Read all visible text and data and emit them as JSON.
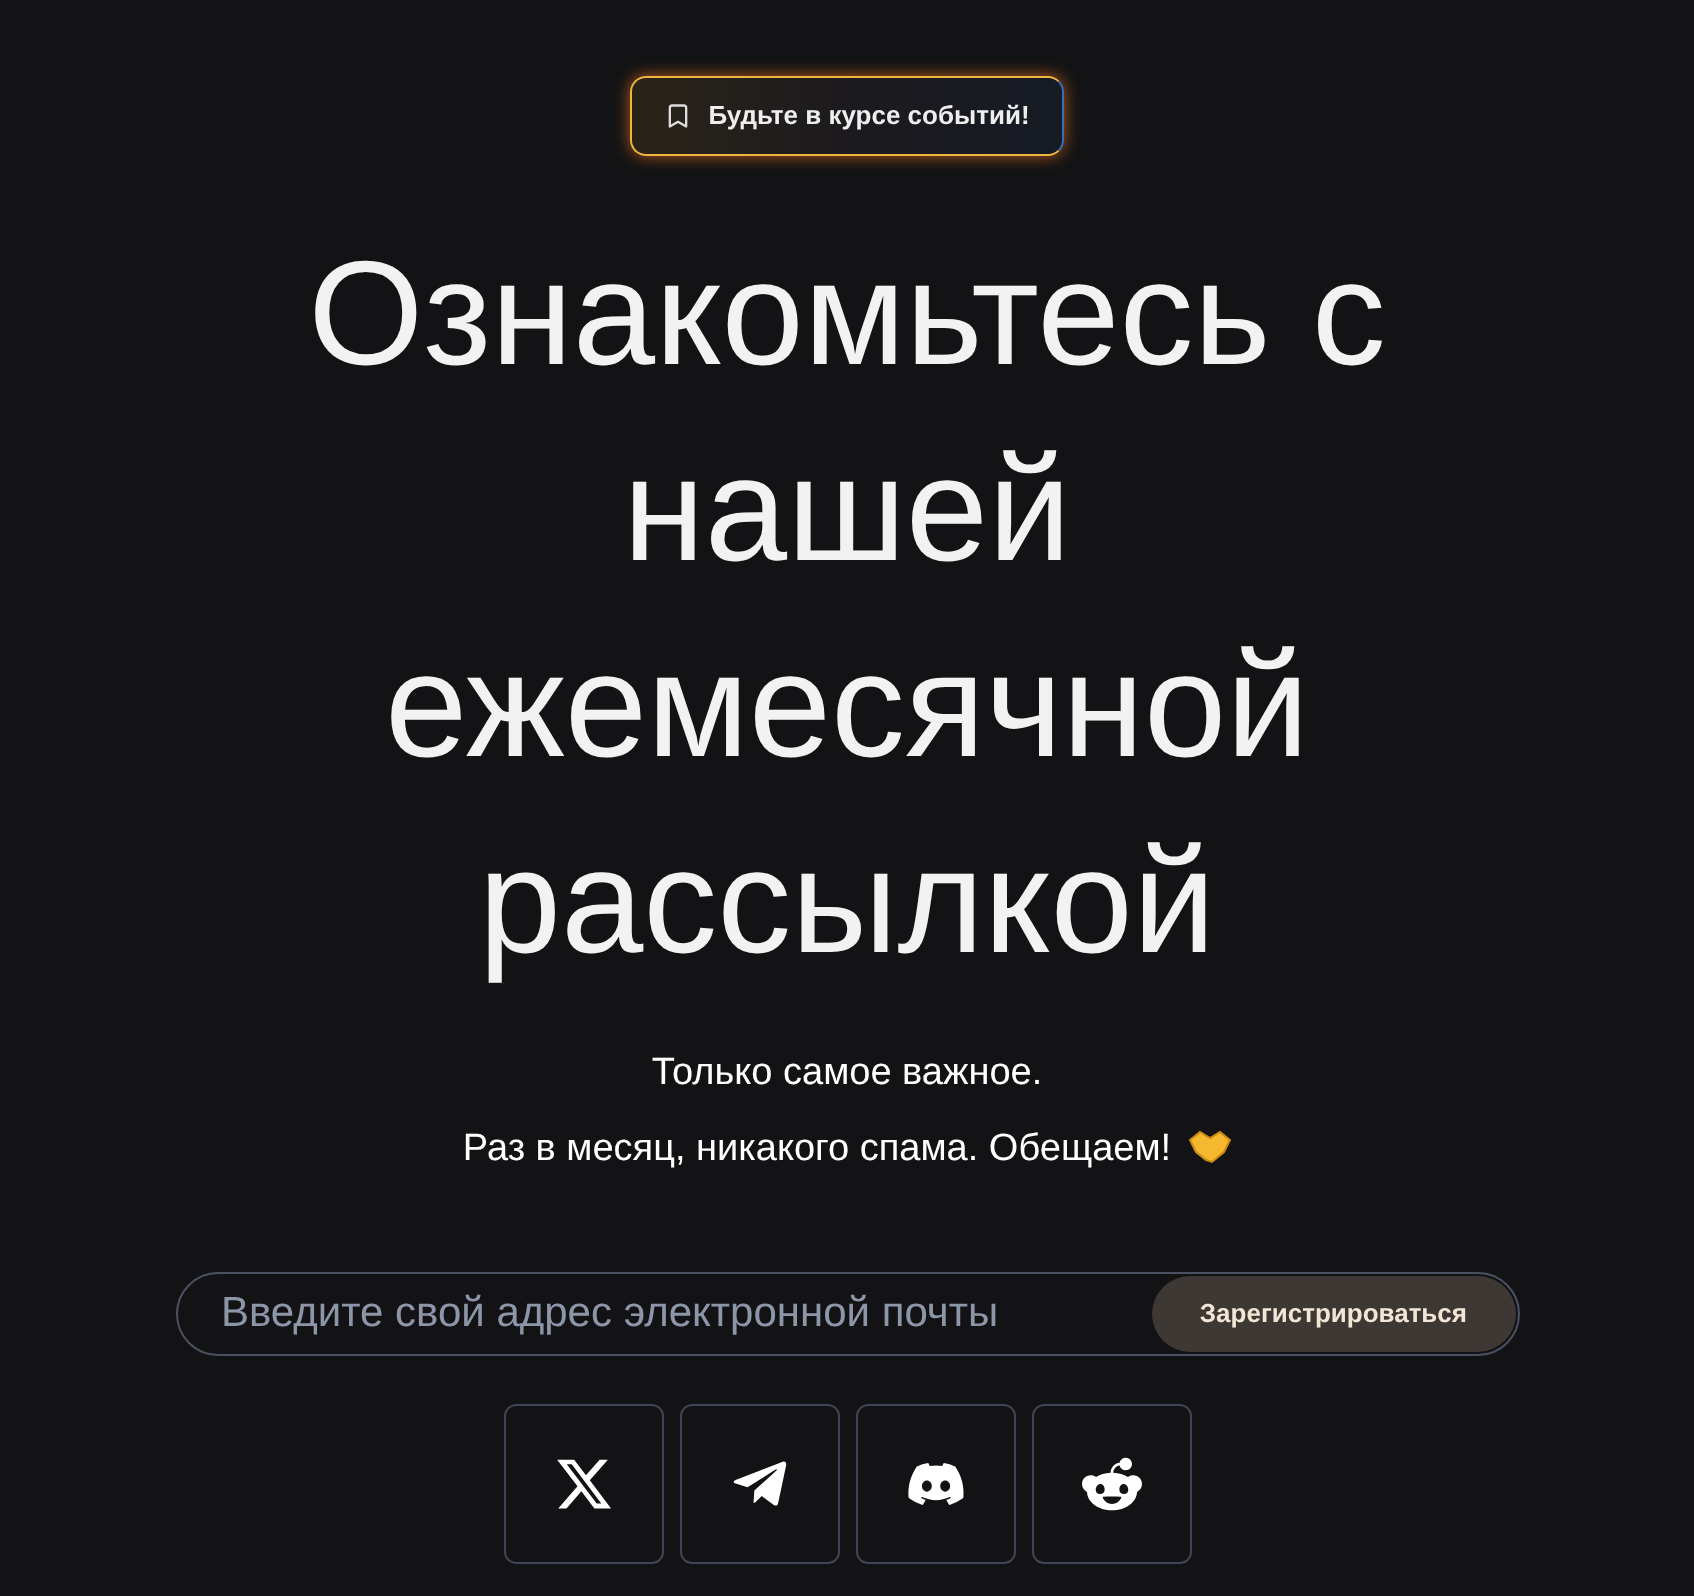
{
  "badge": {
    "label": "Будьте в курсе событий!"
  },
  "title": "Ознакомьтесь с нашей ежемесячной рассылкой",
  "subtitle": [
    "Только самое важное.",
    "Раз в месяц, никакого спама. Обещаем!"
  ],
  "signup": {
    "placeholder": "Введите свой адрес электронной почты",
    "button": "Зарегистрироваться"
  },
  "socials": [
    {
      "kind": "x"
    },
    {
      "kind": "telegram"
    },
    {
      "kind": "discord"
    },
    {
      "kind": "reddit"
    }
  ]
}
